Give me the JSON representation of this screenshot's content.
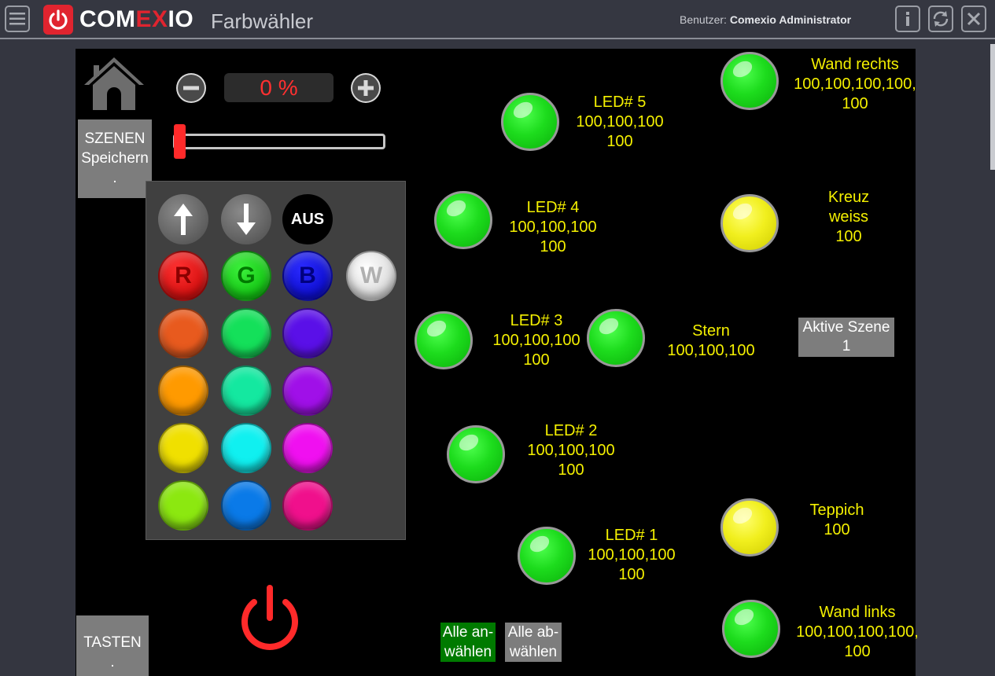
{
  "header": {
    "brand_left": "COM",
    "brand_mid": "EX",
    "brand_right": "IO",
    "page_title": "Farbwähler",
    "user_label": "Benutzer:",
    "user_name": "Comexio Administrator",
    "brand_color": "#e0242f"
  },
  "dimmer": {
    "value_text": "0 %",
    "level": 0
  },
  "buttons": {
    "szenen_line1": "SZENEN",
    "szenen_line2": "Speichern",
    "szenen_line3": ".",
    "tasten_line1": "TASTEN",
    "tasten_line2": ".",
    "aus": "AUS",
    "r": "R",
    "g": "G",
    "b": "B",
    "w": "W",
    "alle_an_line1": "Alle an-",
    "alle_an_line2": "wählen",
    "alle_ab_line1": "Alle ab-",
    "alle_ab_line2": "wählen"
  },
  "palette_colors": [
    "#e85a1e",
    "#14e05a",
    "#5a10e8",
    "#ff9a00",
    "#14e8a0",
    "#a010e8",
    "#f0e000",
    "#10f0f0",
    "#f010f0",
    "#8ce810",
    "#0a7ae8",
    "#f0108c"
  ],
  "lamps": {
    "led5": {
      "name": "LED# 5",
      "line2": "100,100,100",
      "line3": "100"
    },
    "led4": {
      "name": "LED# 4",
      "line2": "100,100,100",
      "line3": "100"
    },
    "led3": {
      "name": "LED# 3",
      "line2": "100,100,100",
      "line3": "100"
    },
    "led2": {
      "name": "LED# 2",
      "line2": "100,100,100",
      "line3": "100"
    },
    "led1": {
      "name": "LED# 1",
      "line2": "100,100,100",
      "line3": "100"
    },
    "stern": {
      "name": "Stern",
      "line2": "100,100,100"
    },
    "wand_rechts": {
      "name": "Wand rechts",
      "line2": "100,100,100,100,",
      "line3": "100"
    },
    "kreuz": {
      "name": "Kreuz",
      "line2": "weiss",
      "line3": "100"
    },
    "teppich": {
      "name": "Teppich",
      "line2": "100"
    },
    "wand_links": {
      "name": "Wand links",
      "line2": "100,100,100,100,",
      "line3": "100"
    }
  },
  "aktive_szene": {
    "line1": "Aktive Szene",
    "line2": "1"
  }
}
